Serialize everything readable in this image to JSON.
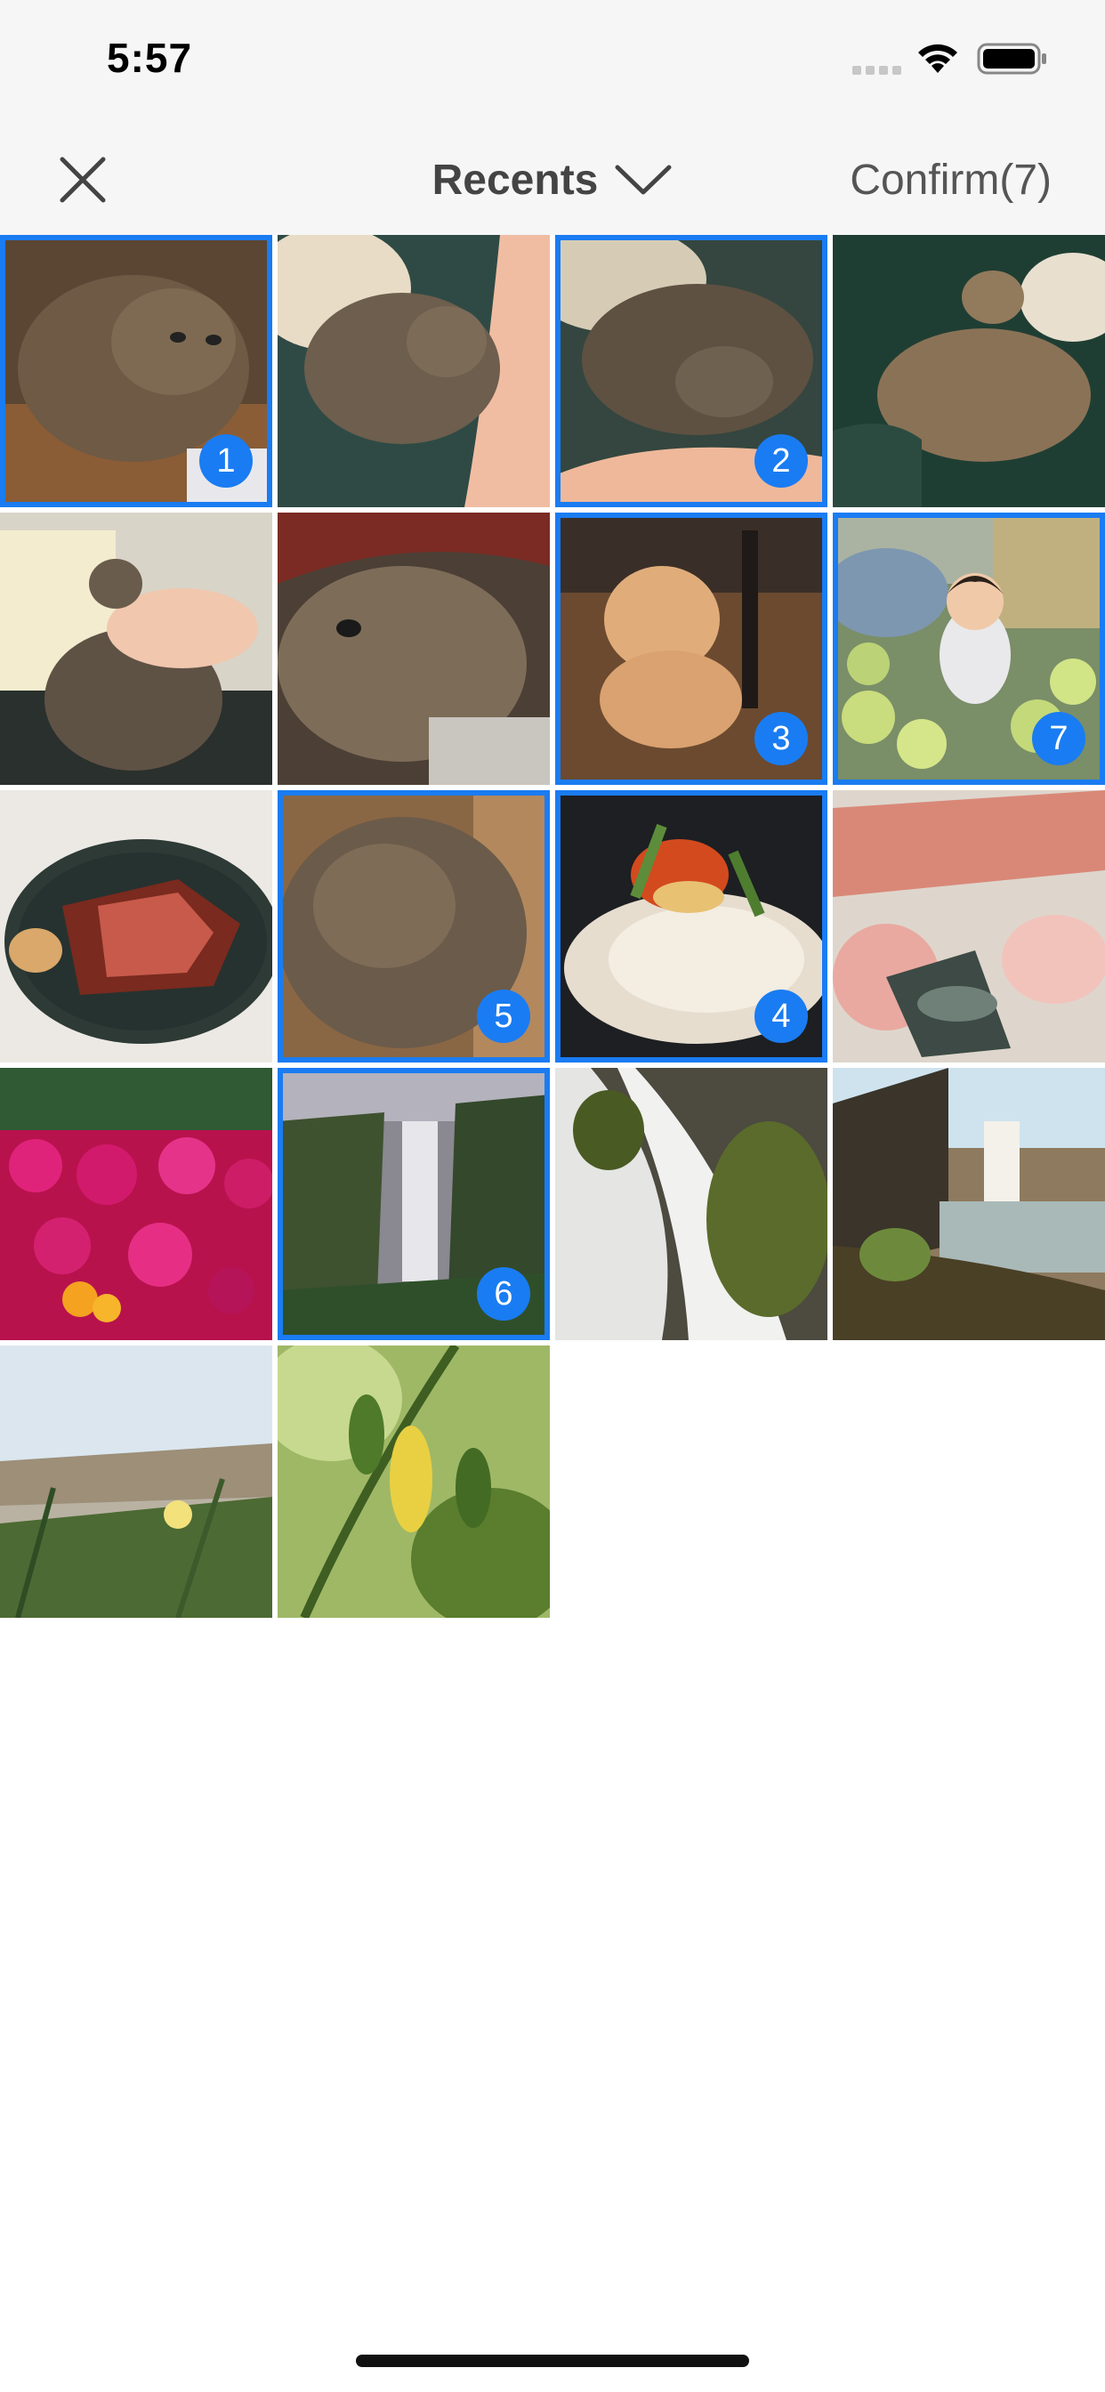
{
  "status_bar": {
    "time": "5:57"
  },
  "nav": {
    "album_title": "Recents",
    "confirm_label": "Confirm(7)"
  },
  "icons": {
    "close": "close-icon",
    "album_dropdown": "chevron-down-icon",
    "signal": "cellular-signal-icon",
    "wifi": "wifi-icon",
    "battery": "battery-icon"
  },
  "colors": {
    "accent": "#1a7cf2",
    "bar_background": "#f6f6f6"
  },
  "photos": [
    {
      "subject": "tabby cat lying on rug",
      "selected": true,
      "order": "1"
    },
    {
      "subject": "tabby cat curled on arm",
      "selected": false,
      "order": ""
    },
    {
      "subject": "tabby cat resting on arm",
      "selected": true,
      "order": "2"
    },
    {
      "subject": "tabby cat stretched on sofa",
      "selected": false,
      "order": ""
    },
    {
      "subject": "cat being petted on sofa",
      "selected": false,
      "order": ""
    },
    {
      "subject": "tabby cat close-up",
      "selected": false,
      "order": ""
    },
    {
      "subject": "fluffy dog on wooden floor",
      "selected": true,
      "order": "3"
    },
    {
      "subject": "toddler in ball pit",
      "selected": true,
      "order": "7"
    },
    {
      "subject": "steak on plate",
      "selected": false,
      "order": ""
    },
    {
      "subject": "cat sleeping curled",
      "selected": true,
      "order": "5"
    },
    {
      "subject": "salmon roe dish",
      "selected": true,
      "order": "4"
    },
    {
      "subject": "raw meat and shrimp platter",
      "selected": false,
      "order": ""
    },
    {
      "subject": "pink flower field",
      "selected": false,
      "order": ""
    },
    {
      "subject": "waterfall in valley",
      "selected": true,
      "order": "6"
    },
    {
      "subject": "long exposure waterfall",
      "selected": false,
      "order": ""
    },
    {
      "subject": "waterfall with sunlight",
      "selected": false,
      "order": ""
    },
    {
      "subject": "yellow flower by beach",
      "selected": false,
      "order": ""
    },
    {
      "subject": "green plant with yellow leaf",
      "selected": false,
      "order": ""
    }
  ]
}
